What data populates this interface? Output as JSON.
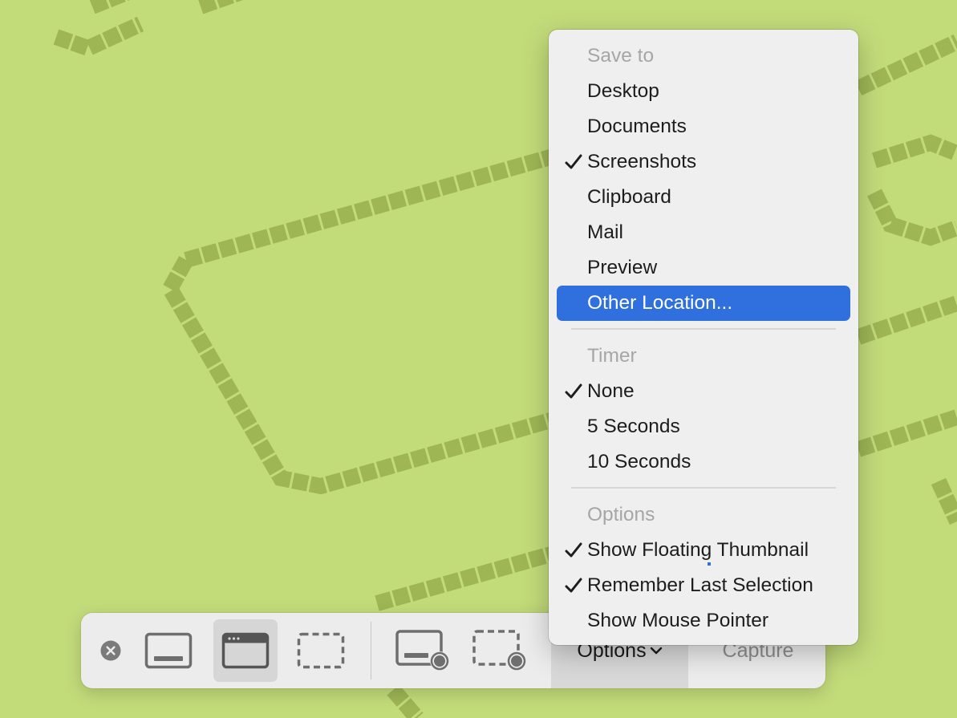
{
  "colors": {
    "wallpaper": "#c3dc7a",
    "wallpaper_pattern": "#9fb655",
    "menu_highlight": "#2f6fde",
    "menu_header_text": "#a6a6a6"
  },
  "toolbar": {
    "close_icon": "close-circle-icon",
    "buttons": [
      {
        "name": "capture-entire-screen",
        "icon": "screen-icon",
        "active": false
      },
      {
        "name": "capture-selected-window",
        "icon": "window-icon",
        "active": true
      },
      {
        "name": "capture-selected-portion",
        "icon": "dashed-selection-icon",
        "active": false
      },
      {
        "name": "record-entire-screen",
        "icon": "record-screen-icon",
        "active": false
      },
      {
        "name": "record-selected-portion",
        "icon": "record-selection-icon",
        "active": false
      }
    ],
    "options_label": "Options",
    "options_icon": "chevron-down-icon",
    "capture_label": "Capture"
  },
  "menu": {
    "save_to": {
      "header": "Save to",
      "items": [
        {
          "label": "Desktop",
          "checked": false
        },
        {
          "label": "Documents",
          "checked": false
        },
        {
          "label": "Screenshots",
          "checked": true
        },
        {
          "label": "Clipboard",
          "checked": false
        },
        {
          "label": "Mail",
          "checked": false
        },
        {
          "label": "Preview",
          "checked": false
        },
        {
          "label": "Other Location...",
          "checked": false,
          "highlighted": true
        }
      ]
    },
    "timer": {
      "header": "Timer",
      "items": [
        {
          "label": "None",
          "checked": true
        },
        {
          "label": "5 Seconds",
          "checked": false
        },
        {
          "label": "10 Seconds",
          "checked": false
        }
      ]
    },
    "options": {
      "header": "Options",
      "items": [
        {
          "label": "Show Floating Thumbnail",
          "checked": true
        },
        {
          "label": "Remember Last Selection",
          "checked": true
        },
        {
          "label": "Show Mouse Pointer",
          "checked": false
        }
      ]
    }
  }
}
